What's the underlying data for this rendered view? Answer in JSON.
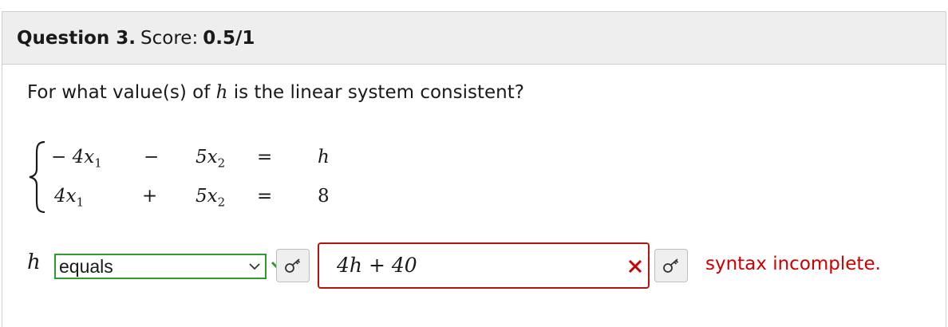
{
  "question": {
    "number_label": "Question 3.",
    "score_label": "Score:",
    "score_value": "0.5/1"
  },
  "prompt": {
    "before": "For what value(s) of",
    "variable": "h",
    "after": "is the linear system consistent?"
  },
  "system": {
    "rows": [
      {
        "t1": "− 4x",
        "t1sub": "1",
        "op": "−",
        "t2": "5x",
        "t2sub": "2",
        "eq": "=",
        "rhs": "h"
      },
      {
        "t1": "4x",
        "t1sub": "1",
        "op": "+",
        "t2": "5x",
        "t2sub": "2",
        "eq": "=",
        "rhs": "8"
      }
    ]
  },
  "answer": {
    "variable": "h",
    "relation_selected": "equals",
    "formula_value": "4h + 40",
    "feedback": "syntax incomplete."
  },
  "colors": {
    "correct_green": "#2e9b2e",
    "error_red": "#cc0000",
    "error_border": "#b0150f"
  },
  "icons": [
    "check-icon",
    "key-icon",
    "close-icon",
    "chevron-down-icon",
    "brace-icon"
  ]
}
